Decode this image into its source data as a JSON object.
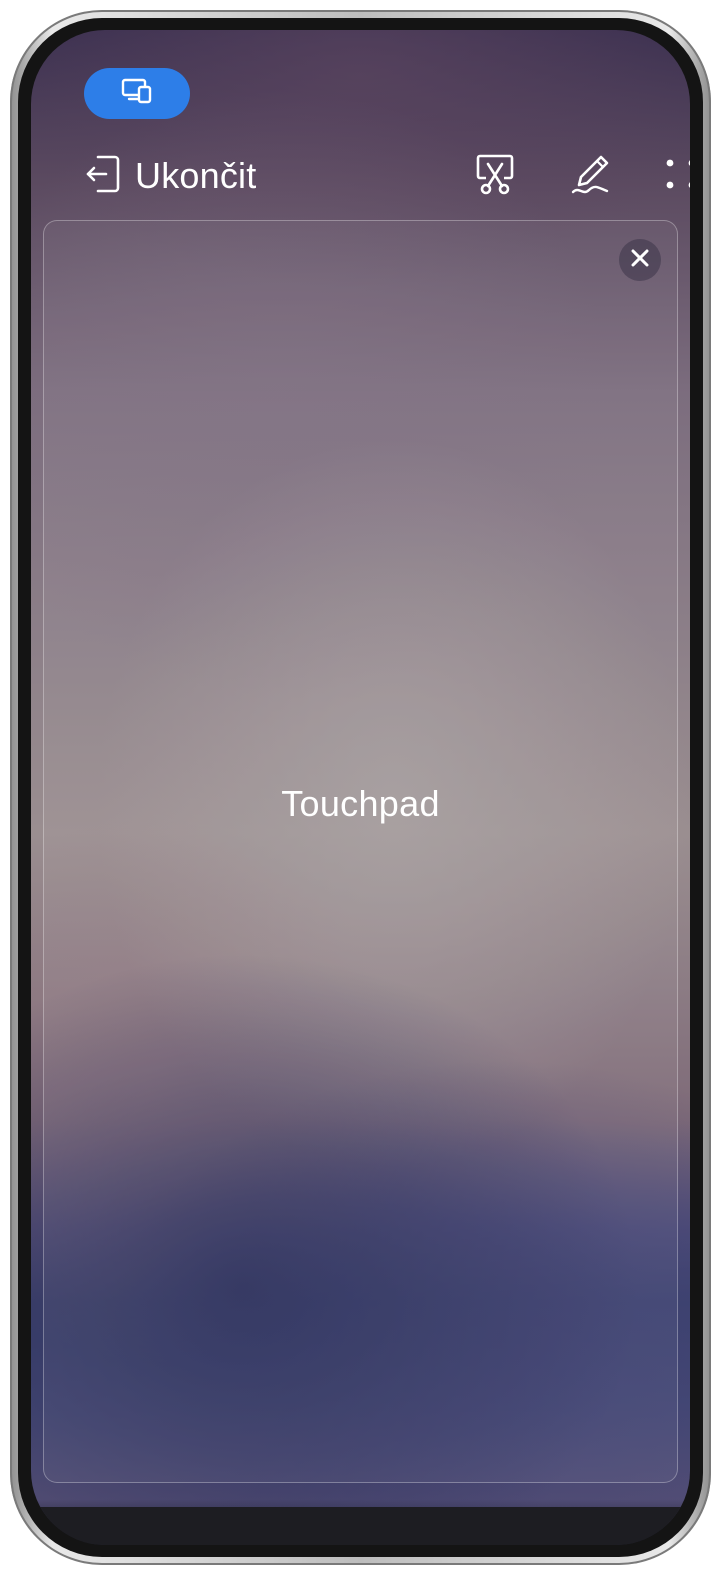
{
  "header": {
    "mode_icon": "phone-pc-devices-icon",
    "exit_icon": "exit-arrow-icon",
    "exit_label": "Ukončit"
  },
  "toolbar": {
    "icons": [
      "screenshot-scissors-icon",
      "annotate-pen-icon",
      "more-dots-icon"
    ]
  },
  "touchpad": {
    "label": "Touchpad",
    "close_icon": "close-icon"
  },
  "colors": {
    "accent": "#2d7ee8",
    "text": "#ffffff"
  }
}
